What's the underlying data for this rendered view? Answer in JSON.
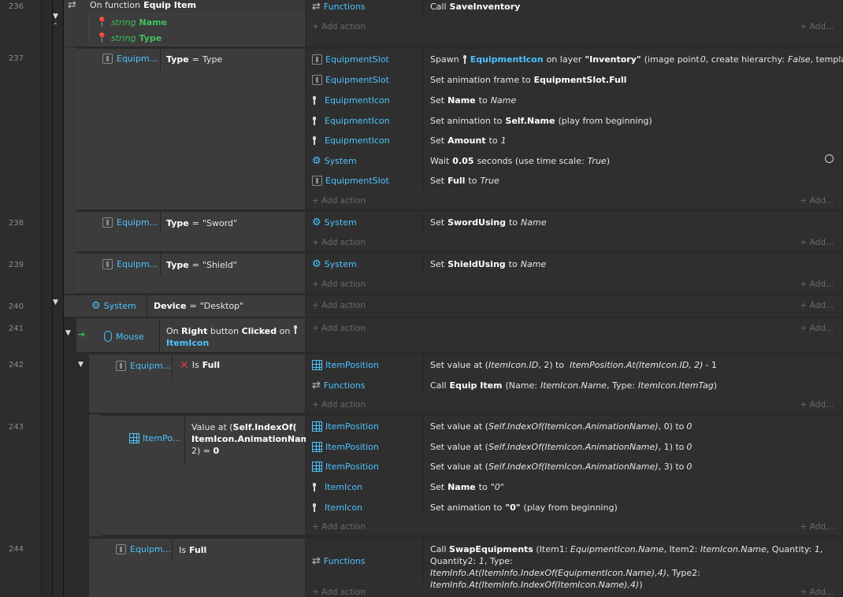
{
  "line_numbers": [
    "236",
    "237",
    "238",
    "239",
    "240",
    "241",
    "242",
    "243",
    "244"
  ],
  "ev236": {
    "title_prefix": "On function",
    "title_name": "Equip Item",
    "params": [
      {
        "type": "string",
        "name": "Name"
      },
      {
        "type": "string",
        "name": "Type"
      }
    ],
    "action_obj": "Functions",
    "action_prefix": "Call",
    "action_name": "SaveInventory"
  },
  "add_action": "+ Add action",
  "add_more": "+ Add...",
  "cond_equipment_short": "Equipm...",
  "ev237": {
    "cond_var": "Type",
    "cond_eq": "=",
    "cond_val": "Type",
    "actions": [
      {
        "obj": "EquipmentSlot"
      },
      {
        "obj": "EquipmentSlot"
      },
      {
        "obj": "EquipmentIcon"
      },
      {
        "obj": "EquipmentIcon"
      },
      {
        "obj": "EquipmentIcon"
      },
      {
        "obj": "System"
      },
      {
        "obj": "EquipmentSlot"
      }
    ],
    "a1": {
      "pre": "Spawn",
      "obj": "EquipmentIcon",
      "mid": "on layer",
      "layer": "\"Inventory\"",
      "p1": "(image point",
      "p2": "0",
      "p3": ", create hierarchy:",
      "p4": "False",
      "p5": ", template: \"\")"
    },
    "a2": {
      "pre": "Set animation frame to",
      "val": "EquipmentSlot.Full"
    },
    "a3": {
      "pre": "Set",
      "var": "Name",
      "mid": "to",
      "val": "Name"
    },
    "a4": {
      "pre": "Set animation to",
      "val": "Self.Name",
      "post": "(play from beginning)"
    },
    "a5": {
      "pre": "Set",
      "var": "Amount",
      "mid": "to",
      "val": "1"
    },
    "a6": {
      "pre": "Wait",
      "val": "0.05",
      "mid": "seconds (use time scale:",
      "val2": "True",
      "post": ")"
    },
    "a7": {
      "pre": "Set",
      "var": "Full",
      "mid": "to",
      "val": "True"
    }
  },
  "ev238": {
    "cond_var": "Type",
    "cond_eq": "=",
    "cond_val": "\"Sword\"",
    "obj": "System",
    "pre": "Set",
    "var": "SwordUsing",
    "mid": "to",
    "val": "Name"
  },
  "ev239": {
    "cond_var": "Type",
    "cond_eq": "=",
    "cond_val": "\"Shield\"",
    "obj": "System",
    "pre": "Set",
    "var": "ShieldUsing",
    "mid": "to",
    "val": "Name"
  },
  "ev240": {
    "obj": "System",
    "cond_var": "Device",
    "cond_eq": "=",
    "cond_val": "\"Desktop\""
  },
  "ev241": {
    "obj": "Mouse",
    "t1": "On",
    "t2": "Right",
    "t3": "button",
    "t4": "Clicked",
    "t5": "on",
    "t6": "ItemIcon"
  },
  "ev242": {
    "cond_is": "Is",
    "cond_full": "Full",
    "a1_obj": "ItemPosition",
    "a1_pre": "Set value at (",
    "a1_v1": "ItemIcon.ID",
    "a1_v2": ", 2) to",
    "a1_v3": "ItemPosition.At(ItemIcon.ID, 2)",
    "a1_v4": "- 1",
    "a2_obj": "Functions",
    "a2_pre": "Call",
    "a2_name": "Equip Item",
    "a2_p1": "(Name:",
    "a2_v1": "ItemIcon.Name",
    "a2_p2": ", Type:",
    "a2_v2": "ItemIcon.ItemTag",
    "a2_p3": ")"
  },
  "ev243": {
    "cond_obj": "ItemPo...",
    "cond_l1a": "Value at (",
    "cond_l1b": "Self.IndexOf(",
    "cond_l2": "ItemIcon.AnimationName)",
    "cond_l2b": ",",
    "cond_l3a": "2) =",
    "cond_l3b": "0",
    "actions": [
      {
        "obj": "ItemPosition",
        "pre": "Set value at (",
        "expr": "Self.IndexOf(ItemIcon.AnimationName)",
        "post": ", 0) to",
        "val": "0"
      },
      {
        "obj": "ItemPosition",
        "pre": "Set value at (",
        "expr": "Self.IndexOf(ItemIcon.AnimationName)",
        "post": ", 1) to",
        "val": "0"
      },
      {
        "obj": "ItemPosition",
        "pre": "Set value at (",
        "expr": "Self.IndexOf(ItemIcon.AnimationName)",
        "post": ", 3) to",
        "val": "0"
      }
    ],
    "a4_obj": "ItemIcon",
    "a4_pre": "Set",
    "a4_var": "Name",
    "a4_mid": "to",
    "a4_val": "\"0\"",
    "a5_obj": "ItemIcon",
    "a5_pre": "Set animation to",
    "a5_val": "\"0\"",
    "a5_post": "(play from beginning)"
  },
  "ev244": {
    "cond_is": "Is",
    "cond_full": "Full",
    "obj": "Functions",
    "l1_pre": "Call",
    "l1_name": "SwapEquipments",
    "l1_p1": "(Item1:",
    "l1_v1": "EquipmentIcon.Name",
    "l1_p2": ", Item2:",
    "l1_v2": "ItemIcon.Name",
    "l1_p3": ", Quantity:",
    "l1_v3": "1",
    "l1_p4": ", Quantity2:",
    "l1_v4": "1",
    "l1_p5": ", Type:",
    "l2_v1": "ItemInfo.At(ItemInfo.IndexOf(EquipmentIcon.Name),4)",
    "l2_p1": ", Type2:",
    "l3_v1": "ItemInfo.At(ItemInfo.IndexOf(ItemIcon.Name),4)",
    "l3_p1": ")"
  }
}
